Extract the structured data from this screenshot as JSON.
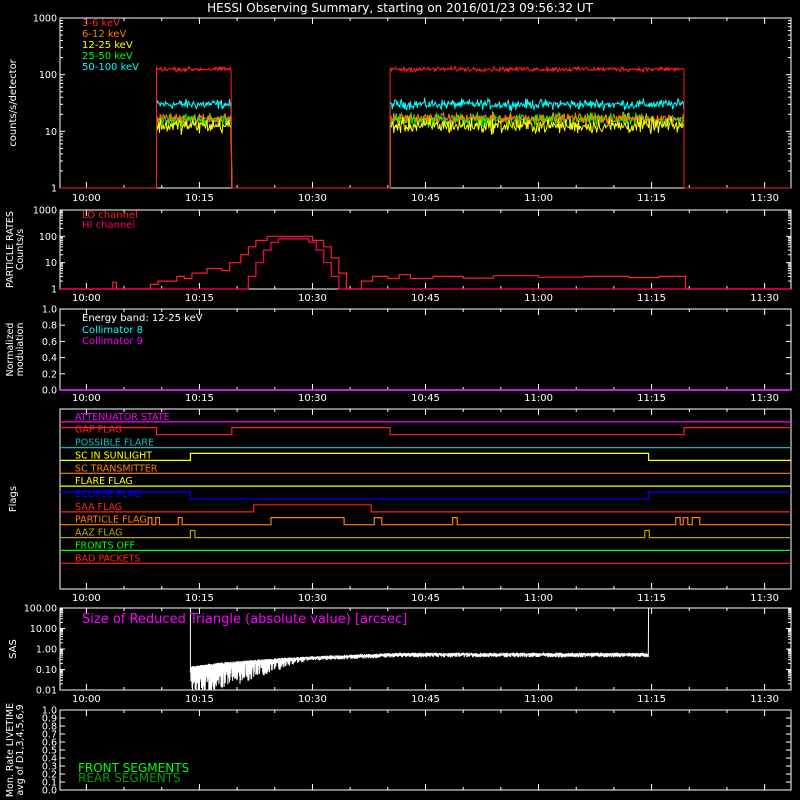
{
  "page": {
    "title": "HESSI Observing Summary, starting on 2016/01/23 09:56:32 UT",
    "background": "#000000",
    "axis_color": "#ffffff",
    "time_ticks": [
      "10:00",
      "10:15",
      "10:30",
      "10:45",
      "11:00",
      "11:15",
      "11:30"
    ],
    "time_tick_minutes": [
      0,
      15,
      30,
      45,
      60,
      75,
      90
    ],
    "time_range_minutes": [
      -3.5,
      93.5
    ]
  },
  "chart_data": [
    {
      "id": "rates",
      "type": "line",
      "ylabel": "counts/s/detector",
      "yscale": "log",
      "ylim": [
        1,
        1000
      ],
      "ytick_values": [
        1,
        10,
        100,
        1000
      ],
      "ytick_labels": [
        "1",
        "10",
        "100",
        "1000"
      ],
      "x_ticks": [
        "10:00",
        "10:15",
        "10:30",
        "10:45",
        "11:00",
        "11:15",
        "11:30"
      ],
      "observing_intervals": [
        [
          9.3,
          19.3
        ],
        [
          40.3,
          79.3
        ]
      ],
      "series": [
        {
          "name": "3-6 keV",
          "color": "#ff2020",
          "level": 125,
          "noise": 0.07
        },
        {
          "name": "6-12 keV",
          "color": "#ff7f00",
          "level": 17,
          "noise": 0.15
        },
        {
          "name": "12-25 keV",
          "color": "#ffff00",
          "level": 12.5,
          "noise": 0.22
        },
        {
          "name": "25-50 keV",
          "color": "#00ff00",
          "level": 16,
          "noise": 0.2
        },
        {
          "name": "50-100 keV",
          "color": "#00ffff",
          "level": 30,
          "noise": 0.15
        }
      ]
    },
    {
      "id": "particle",
      "type": "line",
      "ylabel": [
        "PARTICLE RATES",
        "Counts/s"
      ],
      "yscale": "log",
      "ylim": [
        1,
        1000
      ],
      "ytick_values": [
        1,
        10,
        100,
        1000
      ],
      "ytick_labels": [
        "1",
        "10",
        "100",
        "1000"
      ],
      "x_ticks": [
        "10:00",
        "10:15",
        "10:30",
        "10:45",
        "11:00",
        "11:15",
        "11:30"
      ],
      "series": [
        {
          "name": "LO channel",
          "color": "#ff2020",
          "points": [
            [
              -3.5,
              1
            ],
            [
              3.5,
              1
            ],
            [
              3.5,
              1.8
            ],
            [
              4,
              1.8
            ],
            [
              4,
              1
            ],
            [
              8.5,
              1
            ],
            [
              8.5,
              1.5
            ],
            [
              9.5,
              1.5
            ],
            [
              9.5,
              2
            ],
            [
              12,
              2
            ],
            [
              12,
              3
            ],
            [
              13,
              3
            ],
            [
              13,
              2.5
            ],
            [
              14,
              2.5
            ],
            [
              14,
              4
            ],
            [
              16,
              4
            ],
            [
              16,
              6
            ],
            [
              18,
              6
            ],
            [
              18,
              5
            ],
            [
              19,
              5
            ],
            [
              19,
              10
            ],
            [
              20.5,
              10
            ],
            [
              20.5,
              20
            ],
            [
              21.5,
              20
            ],
            [
              21.5,
              40
            ],
            [
              22.5,
              40
            ],
            [
              22.5,
              70
            ],
            [
              24,
              70
            ],
            [
              24,
              100
            ],
            [
              30,
              100
            ],
            [
              30,
              70
            ],
            [
              31.5,
              70
            ],
            [
              31.5,
              40
            ],
            [
              32.5,
              40
            ],
            [
              32.5,
              15
            ],
            [
              33.5,
              15
            ],
            [
              33.5,
              4
            ],
            [
              34.5,
              4
            ],
            [
              34.5,
              1
            ],
            [
              36.5,
              1
            ],
            [
              36.5,
              2
            ],
            [
              38,
              2
            ],
            [
              38,
              3
            ],
            [
              40,
              3
            ],
            [
              40,
              2.5
            ],
            [
              41.5,
              2.5
            ],
            [
              41.5,
              3.5
            ],
            [
              43,
              3.5
            ],
            [
              43,
              2.5
            ],
            [
              46,
              2.5
            ],
            [
              46,
              3
            ],
            [
              50,
              3
            ],
            [
              50,
              2.6
            ],
            [
              54,
              2.6
            ],
            [
              54,
              3.2
            ],
            [
              60,
              3.2
            ],
            [
              60,
              2.8
            ],
            [
              66,
              2.8
            ],
            [
              66,
              3
            ],
            [
              72,
              3
            ],
            [
              72,
              2.7
            ],
            [
              76,
              2.7
            ],
            [
              76,
              3
            ],
            [
              79.5,
              3
            ],
            [
              79.5,
              1
            ],
            [
              93.5,
              1
            ]
          ]
        },
        {
          "name": "HI channel",
          "color": "#ff0060",
          "points": [
            [
              -3.5,
              1
            ],
            [
              21.5,
              1
            ],
            [
              21.5,
              3
            ],
            [
              22.5,
              3
            ],
            [
              22.5,
              10
            ],
            [
              23.5,
              10
            ],
            [
              23.5,
              30
            ],
            [
              24.5,
              30
            ],
            [
              24.5,
              60
            ],
            [
              25.5,
              60
            ],
            [
              25.5,
              80
            ],
            [
              29.5,
              80
            ],
            [
              29.5,
              60
            ],
            [
              30.5,
              60
            ],
            [
              30.5,
              30
            ],
            [
              31.5,
              30
            ],
            [
              31.5,
              10
            ],
            [
              32.5,
              10
            ],
            [
              32.5,
              3
            ],
            [
              33.5,
              3
            ],
            [
              33.5,
              1
            ],
            [
              93.5,
              1
            ]
          ]
        }
      ]
    },
    {
      "id": "modulation",
      "type": "line",
      "ylabel": [
        "Normalized",
        "modulation"
      ],
      "ylim": [
        0,
        1
      ],
      "ytick_values": [
        0,
        0.2,
        0.4,
        0.6,
        0.8,
        1.0
      ],
      "ytick_labels": [
        "0.0",
        "0.2",
        "0.4",
        "0.6",
        "0.8",
        "1.0"
      ],
      "x_ticks": [
        "10:00",
        "10:15",
        "10:30",
        "10:45",
        "11:00",
        "11:15",
        "11:30"
      ],
      "annotation": "Energy band: 12-25 keV",
      "series": [
        {
          "name": "Collimator 8",
          "color": "#00ffff",
          "points": [
            [
              -3.5,
              0
            ],
            [
              93.5,
              0
            ]
          ]
        },
        {
          "name": "Collimator 9",
          "color": "#ff00ff",
          "points": [
            [
              -3.5,
              0
            ],
            [
              93.5,
              0
            ]
          ]
        }
      ]
    },
    {
      "id": "flags",
      "type": "line",
      "ylabel": "Flags",
      "ylim": [
        0,
        14
      ],
      "x_ticks": [
        "10:00",
        "10:15",
        "10:30",
        "10:45",
        "11:00",
        "11:15",
        "11:30"
      ],
      "series": [
        {
          "name": "ATTENUATOR STATE",
          "color": "#ff00ff",
          "base": 13,
          "high": []
        },
        {
          "name": "GAP FLAG",
          "color": "#ff2020",
          "base": 12,
          "high": [
            [
              -3.5,
              9.3
            ],
            [
              19.3,
              40.3
            ],
            [
              79.3,
              93.5
            ]
          ]
        },
        {
          "name": "POSSIBLE FLARE",
          "color": "#00c0c0",
          "base": 11,
          "high": []
        },
        {
          "name": "SC IN SUNLIGHT",
          "color": "#ffff00",
          "base": 10,
          "high": [
            [
              13.8,
              74.6
            ]
          ]
        },
        {
          "name": "SC TRANSMITTER",
          "color": "#ff7f00",
          "base": 9,
          "high": []
        },
        {
          "name": "FLARE FLAG",
          "color": "#ffff00",
          "base": 8,
          "high": []
        },
        {
          "name": "ECLIPSE FLAG",
          "color": "#0000ff",
          "base": 7,
          "high": [
            [
              -3.5,
              13.8
            ],
            [
              74.6,
              93.5
            ]
          ]
        },
        {
          "name": "SAA FLAG",
          "color": "#ff2020",
          "base": 6,
          "high": [
            [
              22.2,
              37.8
            ]
          ]
        },
        {
          "name": "PARTICLE FLAG",
          "color": "#ff7f00",
          "base": 5,
          "high": [
            [
              8.2,
              8.7
            ],
            [
              9.2,
              9.7
            ],
            [
              12.2,
              12.7
            ],
            [
              24.5,
              34.2
            ],
            [
              38.2,
              39.2
            ],
            [
              48.6,
              49.2
            ],
            [
              78.2,
              78.8
            ],
            [
              79.2,
              79.8
            ],
            [
              80.4,
              81.4
            ]
          ]
        },
        {
          "name": "AAZ FLAG",
          "color": "#c0a000",
          "base": 4,
          "high": [
            [
              13.8,
              14.4
            ],
            [
              74.1,
              74.7
            ]
          ]
        },
        {
          "name": "FRONTS OFF",
          "color": "#00ff00",
          "base": 3,
          "high": []
        },
        {
          "name": "BAD PACKETS",
          "color": "#ff2020",
          "base": 2,
          "high": []
        }
      ]
    },
    {
      "id": "sas",
      "type": "line",
      "title": "Size of Reduced Triangle (absolute value) [arcsec]",
      "ylabel": "SAS",
      "yscale": "log",
      "ylim": [
        0.01,
        100
      ],
      "ytick_values": [
        0.01,
        0.1,
        1,
        10,
        100
      ],
      "ytick_labels": [
        "0.01",
        "0.10",
        "1.00",
        "10.00",
        "100.00"
      ],
      "x_ticks": [
        "10:00",
        "10:15",
        "10:30",
        "10:45",
        "11:00",
        "11:15",
        "11:30"
      ],
      "series": [
        {
          "name": "",
          "color": "#ffffff",
          "start": 13.8,
          "end": 74.6,
          "spike": 100,
          "floor": 0.01,
          "level_start": 0.12,
          "level_end": 0.55
        }
      ]
    },
    {
      "id": "livetime",
      "type": "line",
      "ylabel": [
        "Mon. Rate LIVETIME",
        "avg of D1,3,4,5,6,9"
      ],
      "ylim": [
        0,
        1
      ],
      "ytick_values": [
        0,
        0.1,
        0.2,
        0.3,
        0.4,
        0.5,
        0.6,
        0.7,
        0.8,
        0.9,
        1.0
      ],
      "ytick_labels": [
        "0.0",
        "0.1",
        "0.2",
        "0.3",
        "0.4",
        "0.5",
        "0.6",
        "0.7",
        "0.8",
        "0.9",
        "1.0"
      ],
      "series": [
        {
          "name": "FRONT SEGMENTS",
          "color": "#00ff00",
          "points": []
        },
        {
          "name": "REAR SEGMENTS",
          "color": "#00a000",
          "points": []
        }
      ]
    }
  ]
}
